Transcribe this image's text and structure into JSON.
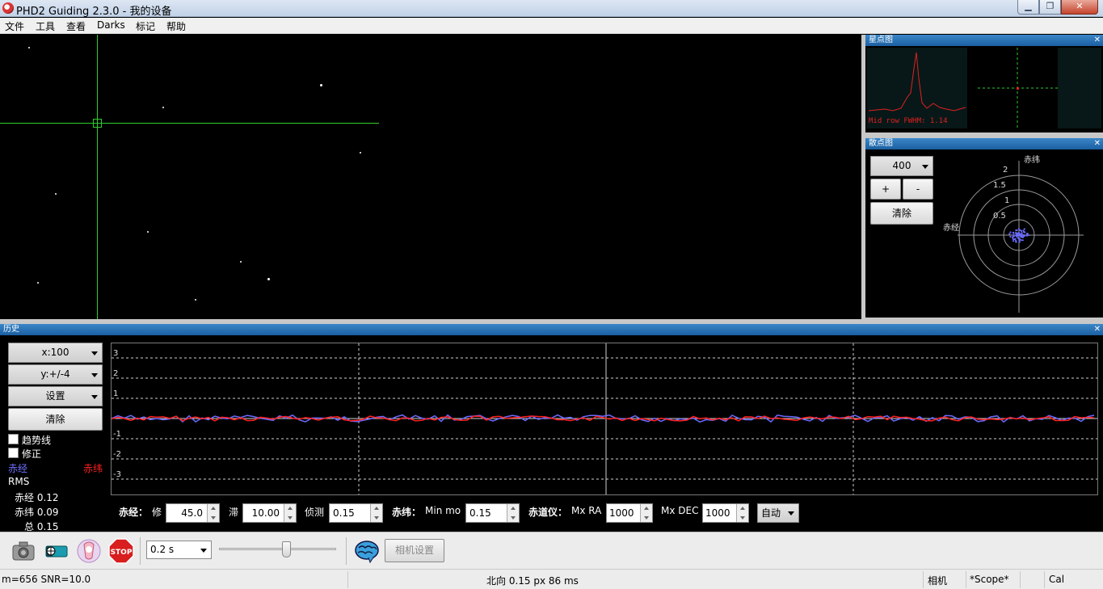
{
  "window": {
    "title": "PHD2 Guiding 2.3.0 - 我的设备"
  },
  "menu": [
    "文件",
    "工具",
    "查看",
    "Darks",
    "标记",
    "帮助"
  ],
  "star_panel": {
    "title": "星点图",
    "fwhm_text": "Mid row FWHM: 1.14"
  },
  "scatter_panel": {
    "title": "散点图",
    "scale_value": "400",
    "plus_label": "+",
    "minus_label": "-",
    "clear_label": "清除",
    "axis_dec_label": "赤纬",
    "axis_ra_label": "赤经",
    "ring_labels": [
      "2",
      "1.5",
      "1",
      "0.5"
    ]
  },
  "history": {
    "title": "历史",
    "x_scale": "x:100",
    "y_scale": "y:+/-4",
    "settings_label": "设置",
    "clear_label": "清除",
    "trendline_label": "趋势线",
    "correction_label": "修正",
    "legend_ra": "赤经",
    "legend_dec": "赤纬",
    "rms_label": "RMS",
    "rms_ra": "赤经  0.12",
    "rms_dec": "赤纬  0.09",
    "rms_total": "总  0.15",
    "y_ticks": [
      "3",
      "2",
      "1",
      "-1",
      "-2",
      "-3"
    ],
    "colors": {
      "ra": "#6b6bff",
      "dec": "#ff2020"
    }
  },
  "controls": {
    "ra_label": "赤经：",
    "ra_aggr_label": "修",
    "ra_aggr_value": "45.0",
    "ra_hyst_label": "滞",
    "ra_hyst_value": "10.00",
    "ra_minmo_label": "侦测",
    "ra_minmo_value": "0.15",
    "dec_label": "赤纬：",
    "dec_minmo_label": "Min mo",
    "dec_minmo_value": "0.15",
    "mount_label": "赤道仪：",
    "mx_ra_label": "Mx RA",
    "mx_ra_value": "1000",
    "mx_dec_label": "Mx DEC",
    "mx_dec_value": "1000",
    "dec_mode_value": "自动"
  },
  "toolbar": {
    "exposure_value": "0.2 s",
    "camera_settings_label": "相机设置",
    "icons": [
      "camera-loop-icon",
      "guide-icon",
      "calibration-icon",
      "stop-icon",
      "brain-icon"
    ]
  },
  "status": {
    "star_info": "m=656 SNR=10.0",
    "guide_info": "北向 0.15 px 86 ms",
    "camera": "相机",
    "scope": "*Scope*",
    "cal": "Cal"
  }
}
